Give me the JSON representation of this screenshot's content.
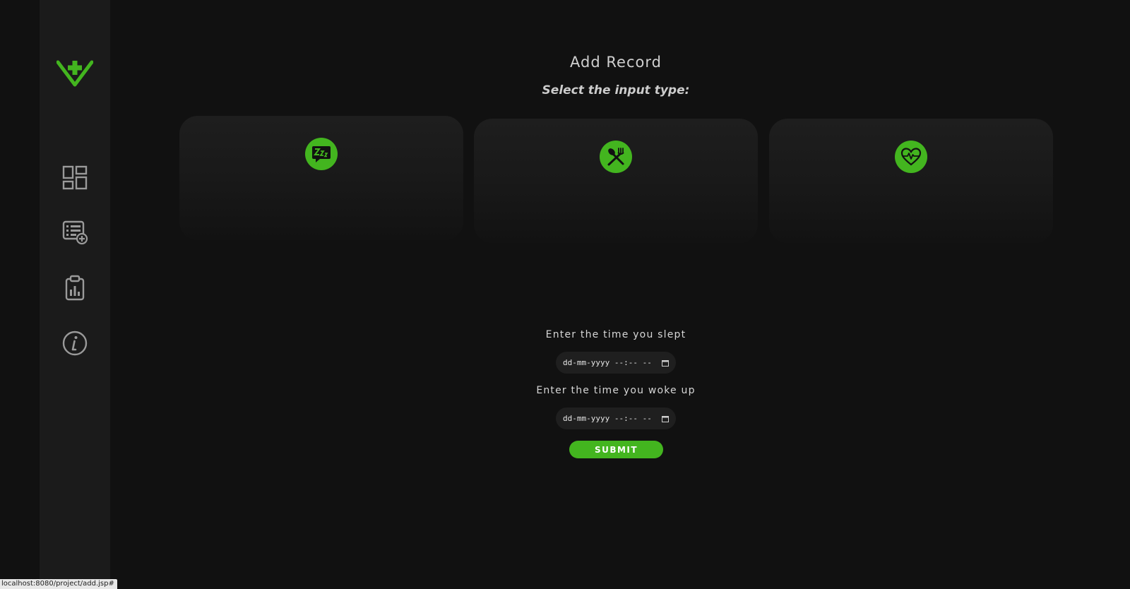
{
  "header": {
    "title": "Add Record",
    "subtitle": "Select the input type:"
  },
  "sidebar": {
    "logo": "heart-plus-logo-icon",
    "items": [
      {
        "icon": "dashboard-icon"
      },
      {
        "icon": "add-record-icon"
      },
      {
        "icon": "report-clipboard-icon"
      },
      {
        "icon": "info-icon"
      }
    ]
  },
  "cards": [
    {
      "icon": "sleep-icon"
    },
    {
      "icon": "food-icon"
    },
    {
      "icon": "heart-rate-icon"
    }
  ],
  "form": {
    "slept_label": "Enter the time you slept",
    "slept_placeholder": "dd-mm-yyyy --:-- --",
    "woke_label": "Enter the time you woke up",
    "woke_placeholder": "dd-mm-yyyy --:-- --",
    "submit_label": "SUBMIT"
  },
  "status_bar": {
    "url": "localhost:8080/project/add.jsp#"
  },
  "colors": {
    "accent": "#43b51f",
    "background": "#111111",
    "sidebar": "#1b1b1b",
    "card": "#1e1e1e"
  }
}
